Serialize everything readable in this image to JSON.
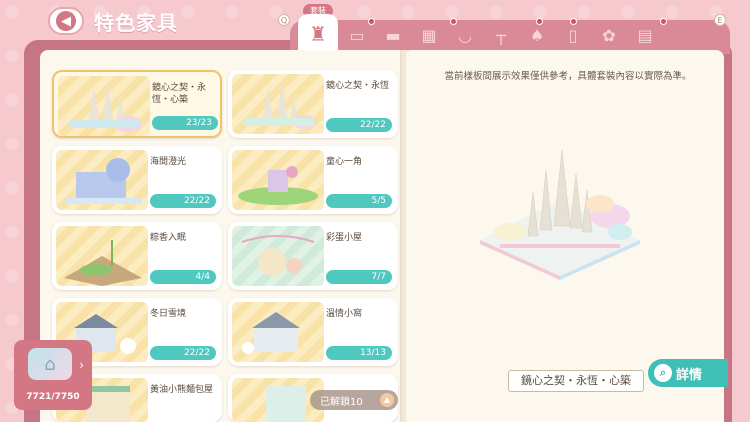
{
  "header": {
    "back_icon": "back-arrow-icon",
    "title": "特色家具"
  },
  "tabs": {
    "active_label": "套裝",
    "left_key": "Q",
    "right_key": "E",
    "icons": [
      "sofa-icon",
      "bed-icon",
      "cabinet-icon",
      "bathtub-icon",
      "table-icon",
      "lamp-icon",
      "fridge-icon",
      "plush-icon",
      "wall-icon"
    ]
  },
  "sets": [
    {
      "name": "鏡心之契・永恆・心築",
      "count": "23/23",
      "selected": true
    },
    {
      "name": "鏡心之契・永恆",
      "count": "22/22"
    },
    {
      "name": "海間澄光",
      "count": "22/22"
    },
    {
      "name": "童心一角",
      "count": "5/5"
    },
    {
      "name": "粽香入眠",
      "count": "4/4"
    },
    {
      "name": "彩蛋小屋",
      "count": "7/7"
    },
    {
      "name": "冬日雪境",
      "count": "22/22"
    },
    {
      "name": "溫情小窩",
      "count": "13/13"
    },
    {
      "name": "黃油小熊麵包屋",
      "count": ""
    },
    {
      "name": "",
      "count": ""
    }
  ],
  "detail": {
    "notice": "當前樣板間展示效果僅供參考，具體套裝內容以實際為準。",
    "set_name": "鏡心之契・永恆・心築",
    "detail_button": "詳情"
  },
  "unlocked_label": "已解鎖10",
  "points": "7721/7750",
  "colors": {
    "accent_teal": "#4fc8c0",
    "book_pink": "#c77584",
    "bg_pink": "#f6c9cf"
  }
}
